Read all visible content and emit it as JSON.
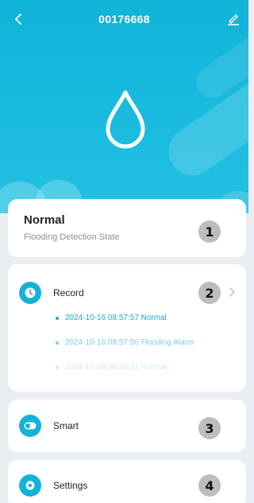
{
  "header": {
    "title": "00176668"
  },
  "state_card": {
    "title": "Normal",
    "subtitle": "Flooding Detection State",
    "badge": "1"
  },
  "record": {
    "label": "Record",
    "badge": "2",
    "entries": [
      "2024-10-16 08:57:57 Normal",
      "2024-10-16 08:57:56 Flooding Alarm",
      "2024-10-16 08:26:31 Normal"
    ]
  },
  "smart": {
    "label": "Smart",
    "badge": "3"
  },
  "settings": {
    "label": "Settings",
    "badge": "4"
  },
  "colors": {
    "accent": "#14b1d8",
    "hero": "#11b3d8"
  },
  "icons": [
    "back-arrow-icon",
    "edit-pencil-icon",
    "water-drop-icon",
    "clock-icon",
    "chevron-right-icon",
    "toggle-icon",
    "gear-icon"
  ]
}
